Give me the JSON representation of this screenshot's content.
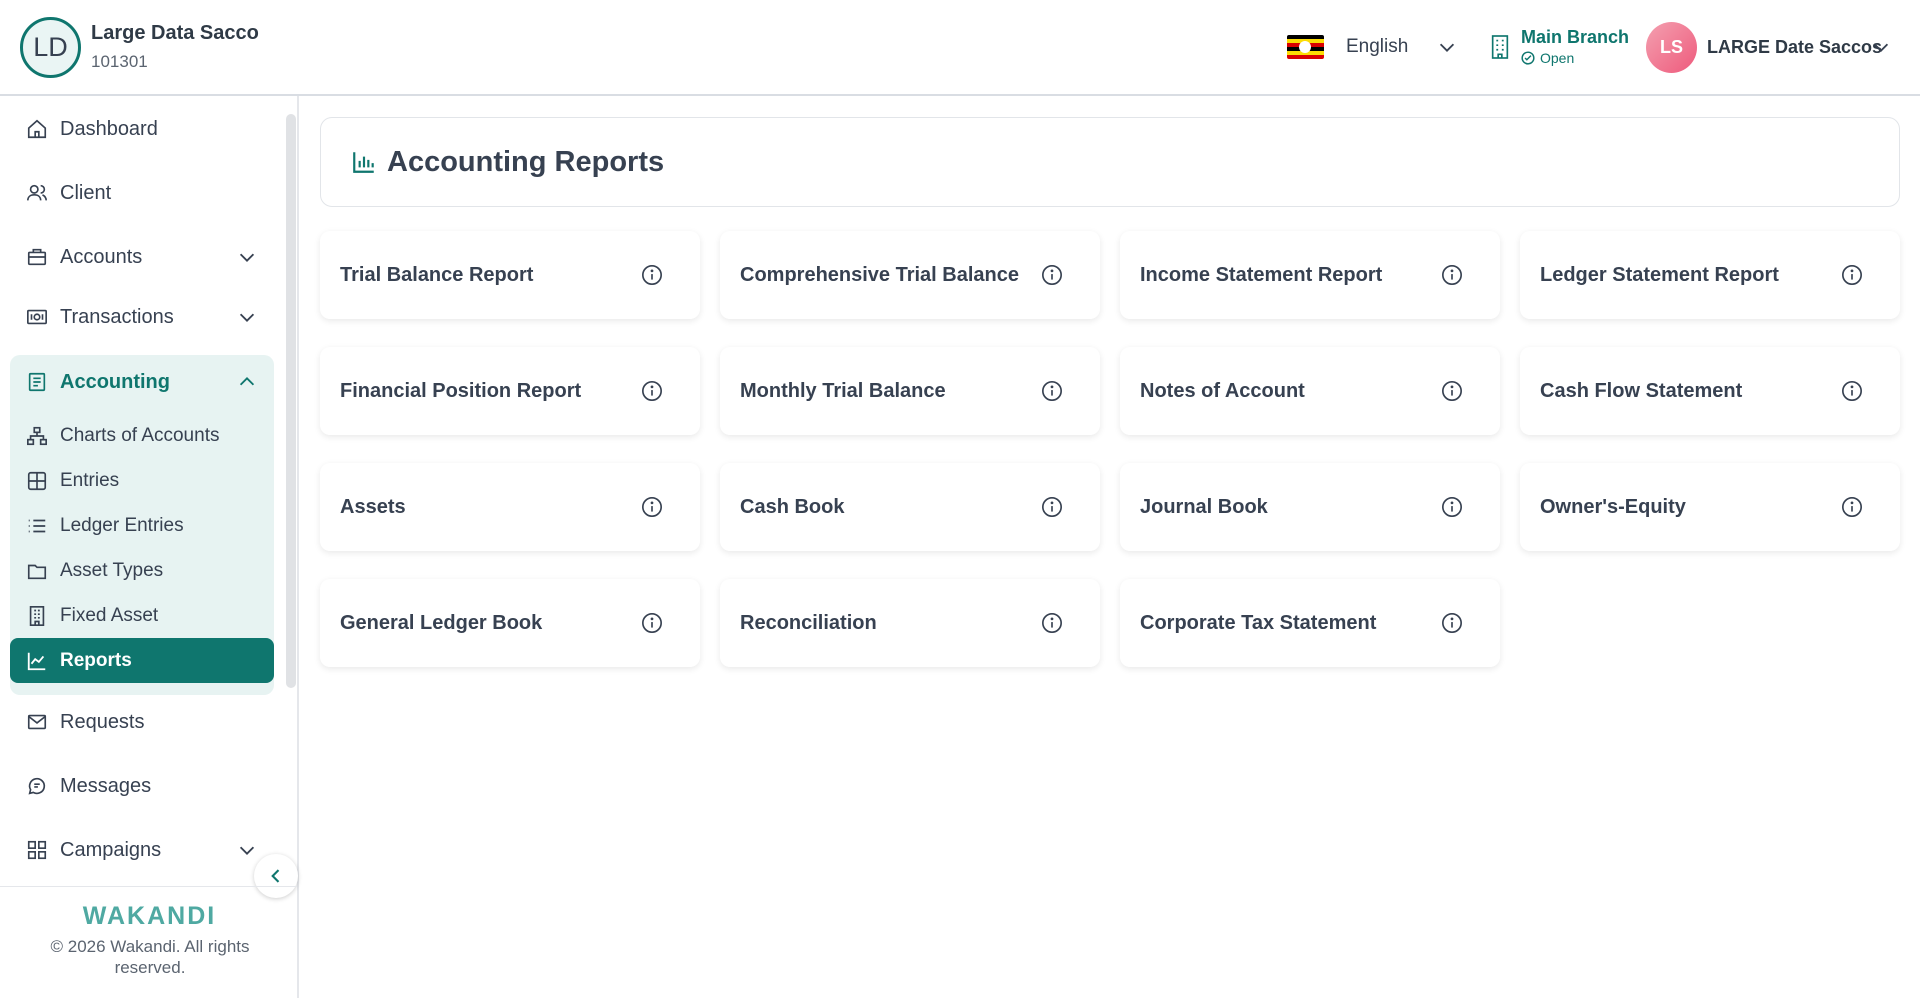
{
  "header": {
    "org_initials": "LD",
    "org_name": "Large Data Sacco",
    "org_code": "101301",
    "language": "English",
    "branch_name": "Main Branch",
    "branch_status": "Open",
    "user_initials": "LS",
    "user_name": "LARGE Date Saccos"
  },
  "sidebar": {
    "items": [
      {
        "label": "Dashboard",
        "icon": "home-icon"
      },
      {
        "label": "Client",
        "icon": "users-icon"
      },
      {
        "label": "Accounts",
        "icon": "briefcase-icon"
      },
      {
        "label": "Transactions",
        "icon": "money-icon"
      }
    ],
    "accounting": {
      "label": "Accounting",
      "sub_items": [
        {
          "label": "Charts of Accounts",
          "icon": "hierarchy-icon"
        },
        {
          "label": "Entries",
          "icon": "table-icon"
        },
        {
          "label": "Ledger Entries",
          "icon": "list-icon"
        },
        {
          "label": "Asset Types",
          "icon": "folder-icon"
        },
        {
          "label": "Fixed Asset",
          "icon": "building-icon"
        },
        {
          "label": "Reports",
          "icon": "chart-line-icon"
        }
      ]
    },
    "lower_items": [
      {
        "label": "Requests",
        "icon": "mail-icon"
      },
      {
        "label": "Messages",
        "icon": "chat-icon"
      },
      {
        "label": "Campaigns",
        "icon": "grid-icon"
      }
    ],
    "brand": "WAKANDI",
    "copyright": "© 2026 Wakandi. All rights reserved."
  },
  "main": {
    "title": "Accounting Reports",
    "reports": [
      "Trial Balance Report",
      "Comprehensive Trial Balance",
      "Income Statement Report",
      "Ledger Statement Report",
      "Financial Position Report",
      "Monthly Trial Balance",
      "Notes of Account",
      "Cash Flow Statement",
      "Assets",
      "Cash Book",
      "Journal Book",
      "Owner's-Equity",
      "General Ledger Book",
      "Reconciliation",
      "Corporate Tax Statement"
    ]
  },
  "colors": {
    "accent": "#0f766e",
    "accent_light": "#e7f3f2",
    "user_avatar": "#ee5a7c"
  }
}
